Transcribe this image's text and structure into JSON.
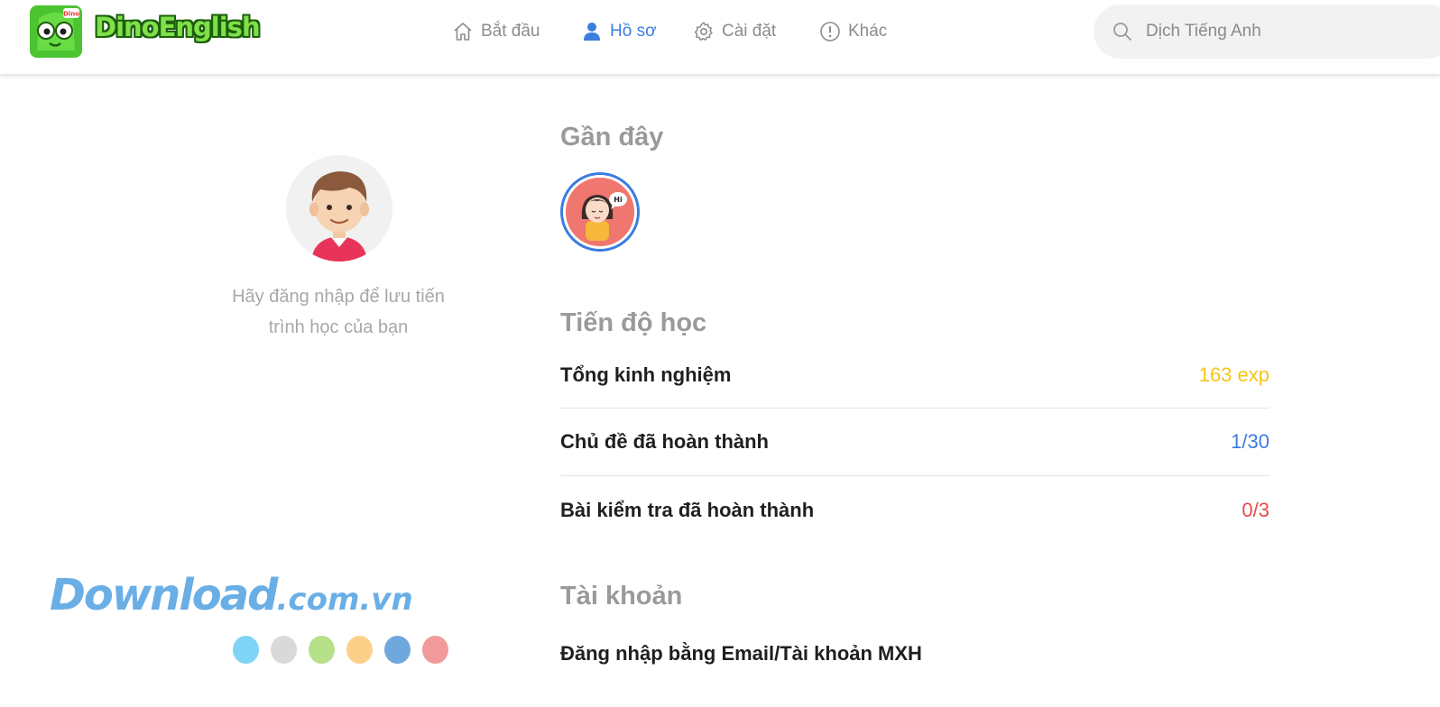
{
  "app": {
    "name": "DinoEnglish",
    "logo_badge": "Dino"
  },
  "nav": [
    {
      "label": "Bắt đầu",
      "icon": "home-icon",
      "active": false
    },
    {
      "label": "Hồ sơ",
      "icon": "user-icon",
      "active": true
    },
    {
      "label": "Cài đặt",
      "icon": "gear-icon",
      "active": false
    },
    {
      "label": "Khác",
      "icon": "info-icon",
      "active": false
    }
  ],
  "search": {
    "placeholder": "Dịch Tiếng Anh",
    "value": ""
  },
  "profile": {
    "avatar": "boy-avatar",
    "login_hint_line1": "Hãy đăng nhập để lưu tiến",
    "login_hint_line2": "trình học của bạn"
  },
  "recent": {
    "title": "Gần đây",
    "items": [
      {
        "avatar": "girl-hi-avatar",
        "bubble": "Hi"
      }
    ]
  },
  "progress": {
    "title": "Tiến độ học",
    "rows": [
      {
        "label": "Tổng kinh nghiệm",
        "value": "163 exp",
        "color": "#f5c518"
      },
      {
        "label": "Chủ đề đã hoàn thành",
        "value": "1/30",
        "color": "#3b7de0"
      },
      {
        "label": "Bài kiểm tra đã hoàn thành",
        "value": "0/3",
        "color": "#e84a4a"
      }
    ]
  },
  "account": {
    "title": "Tài khoản",
    "login_label": "Đăng nhập bằng Email/Tài khoản MXH"
  },
  "watermark": {
    "text_main": "Download",
    "text_domain": ".com.vn",
    "dot_colors": [
      "#7fd3f5",
      "#d9d9d9",
      "#b6e08a",
      "#fdd08a",
      "#6ea8dc",
      "#f29a9a"
    ]
  },
  "colors": {
    "accent": "#3b7de0",
    "nav_inactive": "#8c8c8c",
    "section_title": "#9a9a9a"
  }
}
